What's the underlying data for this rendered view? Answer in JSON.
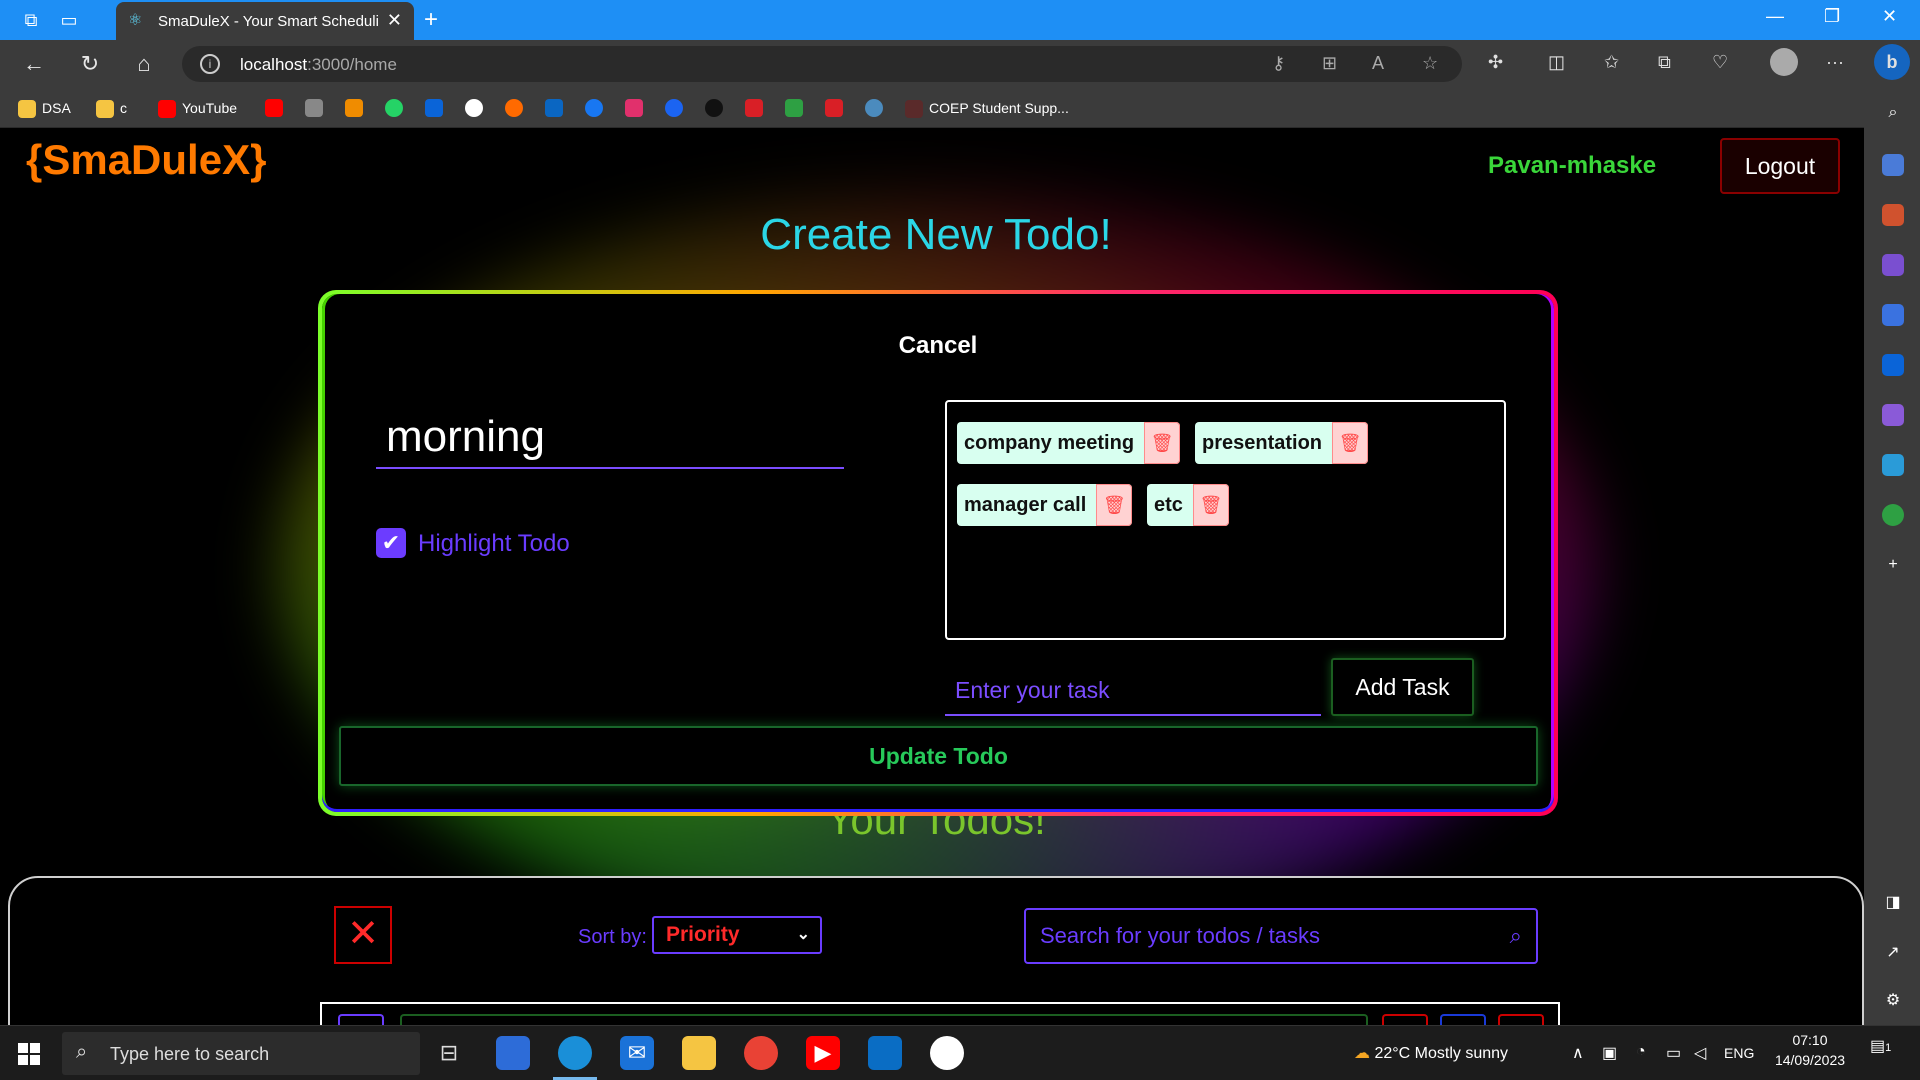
{
  "browser": {
    "tab_title": "SmaDuleX - Your Smart Scheduling",
    "url_host": "localhost",
    "url_rest": ":3000/home",
    "bookmarks": [
      "DSA",
      "c",
      "YouTube",
      "COEP Student Supp..."
    ]
  },
  "header": {
    "brand": "{SmaDuleX}",
    "username": "Pavan-mhaske",
    "logout": "Logout"
  },
  "create": {
    "heading": "Create New Todo!",
    "cancel": "Cancel",
    "title_value": "morning",
    "highlight_label": "Highlight Todo",
    "highlight_checked": true,
    "tasks": [
      "company meeting",
      "presentation",
      "manager call",
      "etc"
    ],
    "task_placeholder": "Enter your task",
    "add_task": "Add Task",
    "update": "Update Todo"
  },
  "list": {
    "heading": "Your Todos!",
    "sort_label": "Sort by:",
    "sort_value": "Priority",
    "search_placeholder": "Search for your todos / tasks"
  },
  "taskbar": {
    "search_placeholder": "Type here to search",
    "weather_temp": "22°C",
    "weather_text": "Mostly sunny",
    "lang": "ENG",
    "time": "07:10",
    "date": "14/09/2023",
    "notifications": "1"
  },
  "colors": {
    "brand": "#ff7a00",
    "username": "#3ad63a",
    "heading_create": "#2bd6e6",
    "accent": "#6a3cff",
    "update": "#27c95a"
  }
}
